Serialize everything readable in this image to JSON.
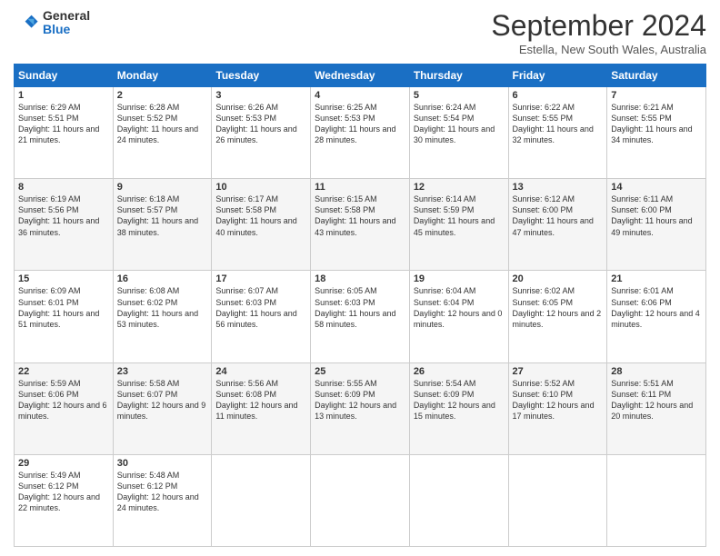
{
  "logo": {
    "general": "General",
    "blue": "Blue"
  },
  "header": {
    "month": "September 2024",
    "location": "Estella, New South Wales, Australia"
  },
  "weekdays": [
    "Sunday",
    "Monday",
    "Tuesday",
    "Wednesday",
    "Thursday",
    "Friday",
    "Saturday"
  ],
  "weeks": [
    [
      {
        "day": "1",
        "sunrise": "6:29 AM",
        "sunset": "5:51 PM",
        "daylight": "11 hours and 21 minutes."
      },
      {
        "day": "2",
        "sunrise": "6:28 AM",
        "sunset": "5:52 PM",
        "daylight": "11 hours and 24 minutes."
      },
      {
        "day": "3",
        "sunrise": "6:26 AM",
        "sunset": "5:53 PM",
        "daylight": "11 hours and 26 minutes."
      },
      {
        "day": "4",
        "sunrise": "6:25 AM",
        "sunset": "5:53 PM",
        "daylight": "11 hours and 28 minutes."
      },
      {
        "day": "5",
        "sunrise": "6:24 AM",
        "sunset": "5:54 PM",
        "daylight": "11 hours and 30 minutes."
      },
      {
        "day": "6",
        "sunrise": "6:22 AM",
        "sunset": "5:55 PM",
        "daylight": "11 hours and 32 minutes."
      },
      {
        "day": "7",
        "sunrise": "6:21 AM",
        "sunset": "5:55 PM",
        "daylight": "11 hours and 34 minutes."
      }
    ],
    [
      {
        "day": "8",
        "sunrise": "6:19 AM",
        "sunset": "5:56 PM",
        "daylight": "11 hours and 36 minutes."
      },
      {
        "day": "9",
        "sunrise": "6:18 AM",
        "sunset": "5:57 PM",
        "daylight": "11 hours and 38 minutes."
      },
      {
        "day": "10",
        "sunrise": "6:17 AM",
        "sunset": "5:58 PM",
        "daylight": "11 hours and 40 minutes."
      },
      {
        "day": "11",
        "sunrise": "6:15 AM",
        "sunset": "5:58 PM",
        "daylight": "11 hours and 43 minutes."
      },
      {
        "day": "12",
        "sunrise": "6:14 AM",
        "sunset": "5:59 PM",
        "daylight": "11 hours and 45 minutes."
      },
      {
        "day": "13",
        "sunrise": "6:12 AM",
        "sunset": "6:00 PM",
        "daylight": "11 hours and 47 minutes."
      },
      {
        "day": "14",
        "sunrise": "6:11 AM",
        "sunset": "6:00 PM",
        "daylight": "11 hours and 49 minutes."
      }
    ],
    [
      {
        "day": "15",
        "sunrise": "6:09 AM",
        "sunset": "6:01 PM",
        "daylight": "11 hours and 51 minutes."
      },
      {
        "day": "16",
        "sunrise": "6:08 AM",
        "sunset": "6:02 PM",
        "daylight": "11 hours and 53 minutes."
      },
      {
        "day": "17",
        "sunrise": "6:07 AM",
        "sunset": "6:03 PM",
        "daylight": "11 hours and 56 minutes."
      },
      {
        "day": "18",
        "sunrise": "6:05 AM",
        "sunset": "6:03 PM",
        "daylight": "11 hours and 58 minutes."
      },
      {
        "day": "19",
        "sunrise": "6:04 AM",
        "sunset": "6:04 PM",
        "daylight": "12 hours and 0 minutes."
      },
      {
        "day": "20",
        "sunrise": "6:02 AM",
        "sunset": "6:05 PM",
        "daylight": "12 hours and 2 minutes."
      },
      {
        "day": "21",
        "sunrise": "6:01 AM",
        "sunset": "6:06 PM",
        "daylight": "12 hours and 4 minutes."
      }
    ],
    [
      {
        "day": "22",
        "sunrise": "5:59 AM",
        "sunset": "6:06 PM",
        "daylight": "12 hours and 6 minutes."
      },
      {
        "day": "23",
        "sunrise": "5:58 AM",
        "sunset": "6:07 PM",
        "daylight": "12 hours and 9 minutes."
      },
      {
        "day": "24",
        "sunrise": "5:56 AM",
        "sunset": "6:08 PM",
        "daylight": "12 hours and 11 minutes."
      },
      {
        "day": "25",
        "sunrise": "5:55 AM",
        "sunset": "6:09 PM",
        "daylight": "12 hours and 13 minutes."
      },
      {
        "day": "26",
        "sunrise": "5:54 AM",
        "sunset": "6:09 PM",
        "daylight": "12 hours and 15 minutes."
      },
      {
        "day": "27",
        "sunrise": "5:52 AM",
        "sunset": "6:10 PM",
        "daylight": "12 hours and 17 minutes."
      },
      {
        "day": "28",
        "sunrise": "5:51 AM",
        "sunset": "6:11 PM",
        "daylight": "12 hours and 20 minutes."
      }
    ],
    [
      {
        "day": "29",
        "sunrise": "5:49 AM",
        "sunset": "6:12 PM",
        "daylight": "12 hours and 22 minutes."
      },
      {
        "day": "30",
        "sunrise": "5:48 AM",
        "sunset": "6:12 PM",
        "daylight": "12 hours and 24 minutes."
      },
      null,
      null,
      null,
      null,
      null
    ]
  ]
}
